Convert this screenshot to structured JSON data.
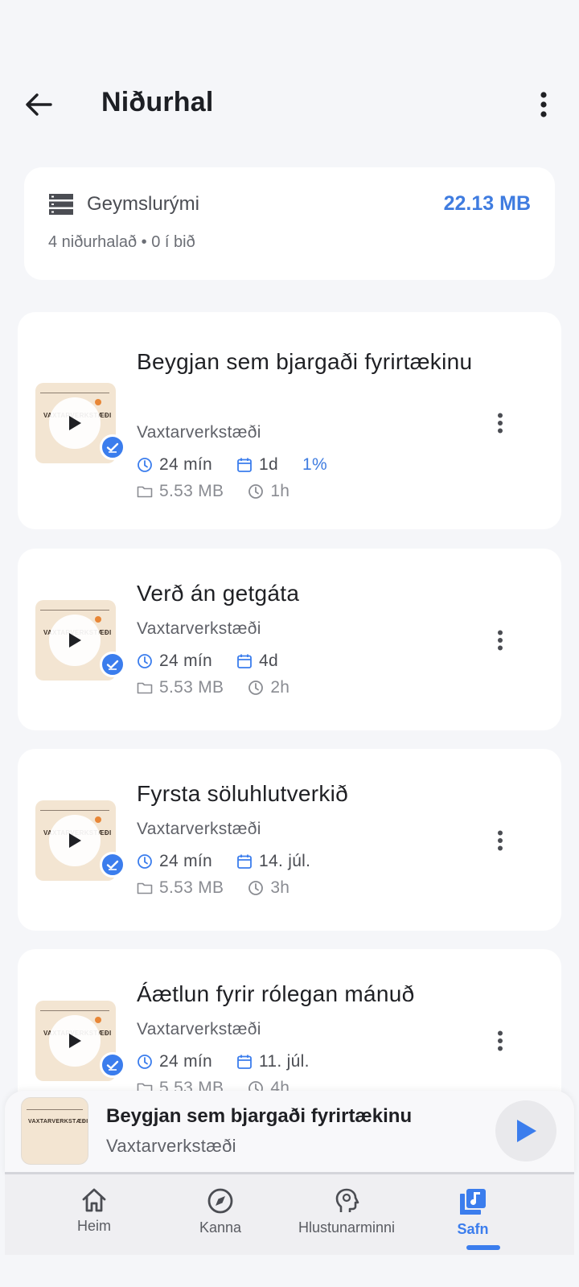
{
  "header": {
    "title": "Niðurhal"
  },
  "storage": {
    "label": "Geymslurými",
    "value": "22.13 MB",
    "summary": "4 niðurhalað • 0 í bið"
  },
  "thumbnail_text": "VAXTARVERKSTÆÐI",
  "episodes": [
    {
      "title": "Beygjan sem bjargaði fyrirtækinu",
      "author": "Vaxtarverkstæði",
      "duration": "24 mín",
      "date": "1d",
      "progress": "1%",
      "size": "5.53 MB",
      "time": "1h"
    },
    {
      "title": "Verð án getgáta",
      "author": "Vaxtarverkstæði",
      "duration": "24 mín",
      "date": "4d",
      "progress": "",
      "size": "5.53 MB",
      "time": "2h"
    },
    {
      "title": "Fyrsta söluhlutverkið",
      "author": "Vaxtarverkstæði",
      "duration": "24 mín",
      "date": "14. júl.",
      "progress": "",
      "size": "5.53 MB",
      "time": "3h"
    },
    {
      "title": "Áætlun fyrir rólegan mánuð",
      "author": "Vaxtarverkstæði",
      "duration": "24 mín",
      "date": "11. júl.",
      "progress": "",
      "size": "5.53 MB",
      "time": "4h"
    }
  ],
  "mini_player": {
    "title": "Beygjan sem bjargaði fyrirtækinu",
    "author": "Vaxtarverkstæði"
  },
  "nav": [
    {
      "label": "Heim",
      "icon": "home-icon"
    },
    {
      "label": "Kanna",
      "icon": "compass-icon"
    },
    {
      "label": "Hlustunarminni",
      "icon": "head-brain-icon"
    },
    {
      "label": "Safn",
      "icon": "library-music-icon",
      "active": true
    }
  ],
  "colors": {
    "accent": "#3b7ded",
    "card": "#ffffff",
    "background": "#f5f6f9",
    "artwork": "#f3e5d2",
    "artwork_accent": "#e88636"
  }
}
